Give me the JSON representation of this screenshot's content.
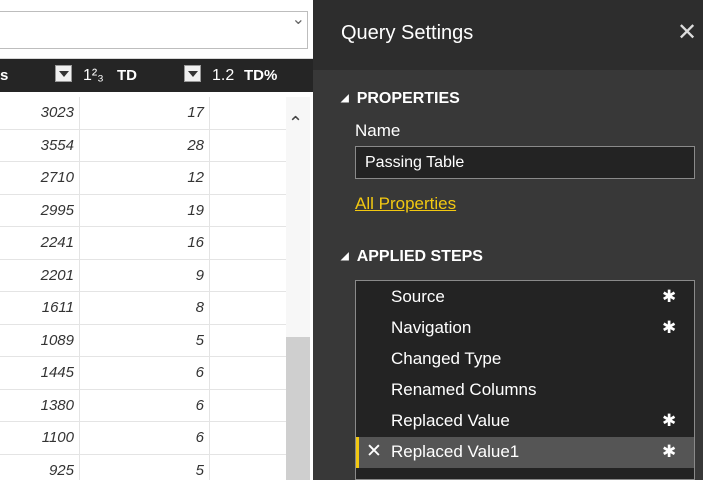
{
  "grid": {
    "columns": [
      {
        "type_icon": "",
        "name": "s"
      },
      {
        "type_icon": "1²₃",
        "name": "TD"
      },
      {
        "type_icon": "1.2",
        "name": "TD%"
      }
    ],
    "rows": [
      {
        "a": "3023",
        "b": "17"
      },
      {
        "a": "3554",
        "b": "28"
      },
      {
        "a": "2710",
        "b": "12"
      },
      {
        "a": "2995",
        "b": "19"
      },
      {
        "a": "2241",
        "b": "16"
      },
      {
        "a": "2201",
        "b": "9"
      },
      {
        "a": "1611",
        "b": "8"
      },
      {
        "a": "1089",
        "b": "5"
      },
      {
        "a": "1445",
        "b": "6"
      },
      {
        "a": "1380",
        "b": "6"
      },
      {
        "a": "1100",
        "b": "6"
      },
      {
        "a": "925",
        "b": "5"
      }
    ]
  },
  "panel": {
    "title": "Query Settings",
    "close": "✕",
    "properties": {
      "heading": "PROPERTIES",
      "name_label": "Name",
      "name_value": "Passing Table",
      "all_properties": "All Properties"
    },
    "applied_steps": {
      "heading": "APPLIED STEPS",
      "steps": [
        {
          "label": "Source",
          "gear": "✱"
        },
        {
          "label": "Navigation",
          "gear": "✱"
        },
        {
          "label": "Changed Type",
          "gear": ""
        },
        {
          "label": "Renamed Columns",
          "gear": ""
        },
        {
          "label": "Replaced Value",
          "gear": "✱"
        },
        {
          "label": "Replaced Value1",
          "gear": "✱",
          "selected": true,
          "delete": "✕"
        }
      ]
    }
  },
  "colors": {
    "accent": "#f2c811",
    "panel_bg": "#383838",
    "header_bg": "#252525"
  }
}
